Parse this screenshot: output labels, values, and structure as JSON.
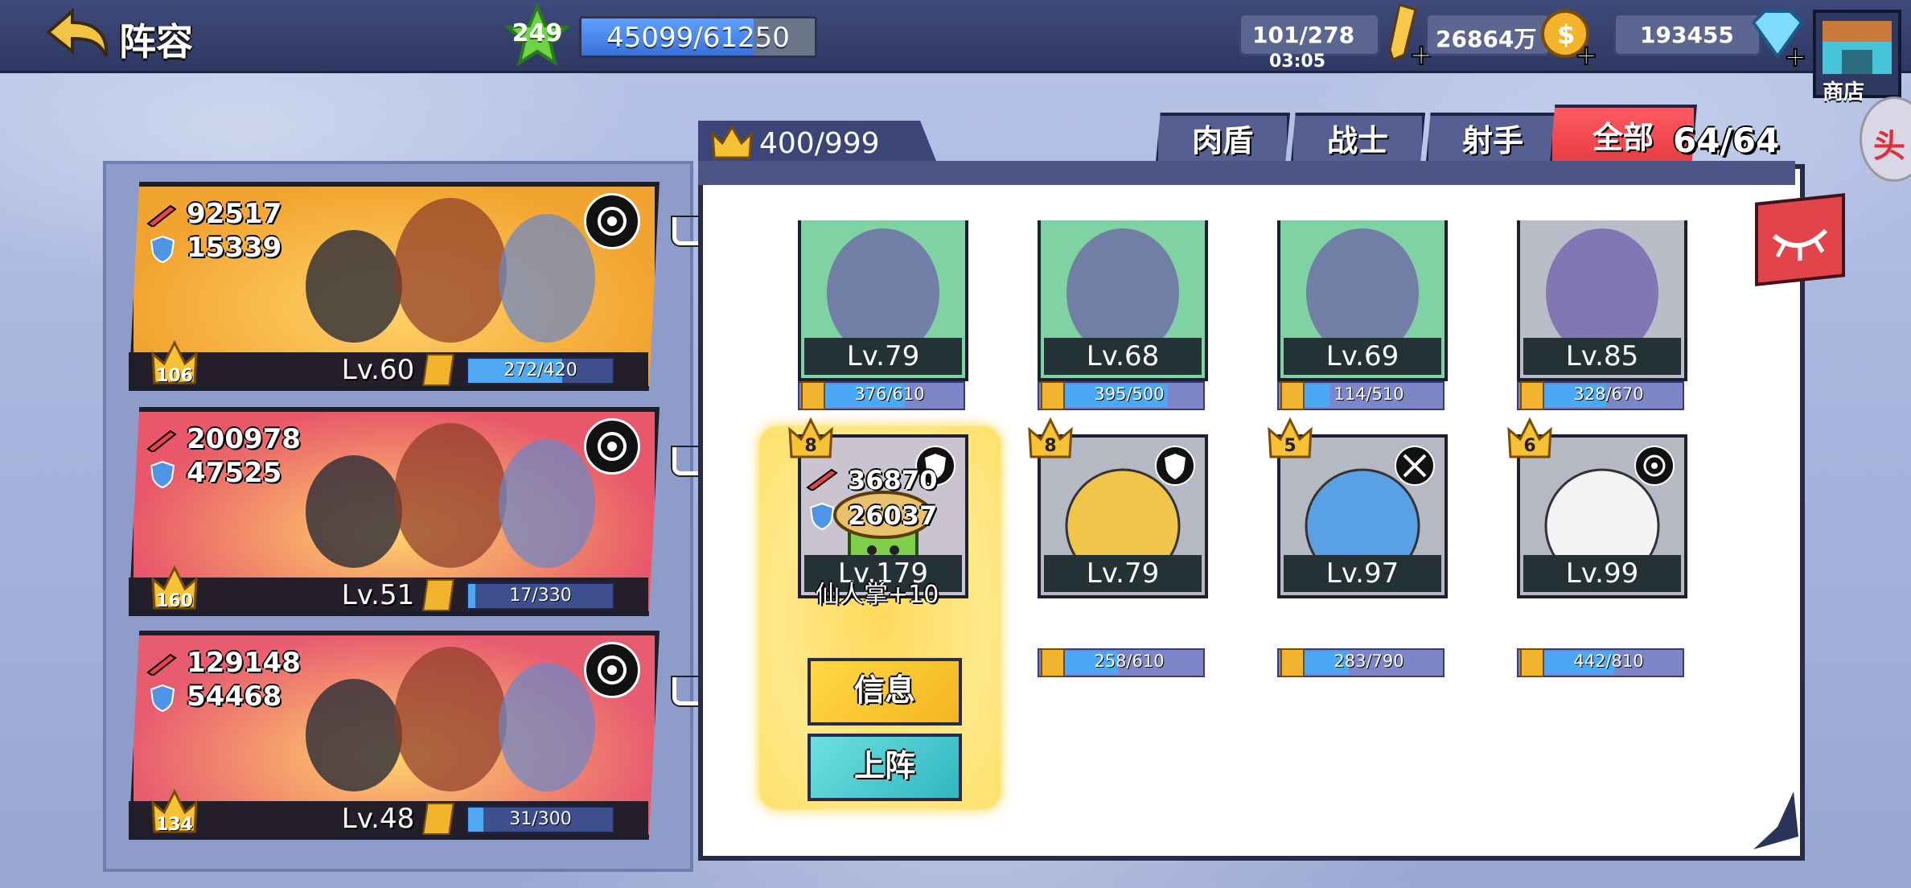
{
  "header": {
    "title": "阵容",
    "level": "249",
    "exp": {
      "text": "45099/61250",
      "current": 45099,
      "max": 61250
    },
    "energy": {
      "value": "101/278",
      "timer": "03:05"
    },
    "gold": {
      "value": "26864万"
    },
    "gems": {
      "value": "193455"
    },
    "shop_label": "商店",
    "side_button_label": "头"
  },
  "team_panel": {
    "teams": [
      {
        "attack": "92517",
        "defense": "15339",
        "crown": "106",
        "level": "Lv.60",
        "shard": "272/420",
        "shard_ratio": 0.648,
        "role_icon": "archer-target-icon",
        "bg": "#f2a430"
      },
      {
        "attack": "200978",
        "defense": "47525",
        "crown": "160",
        "level": "Lv.51",
        "shard": "17/330",
        "shard_ratio": 0.052,
        "role_icon": "archer-target-icon",
        "bg": "#e8586a"
      },
      {
        "attack": "129148",
        "defense": "54468",
        "crown": "134",
        "level": "Lv.48",
        "shard": "31/300",
        "shard_ratio": 0.103,
        "role_icon": "crossed-swords-icon",
        "bg": "#e85c70"
      }
    ]
  },
  "hero_panel": {
    "crown_count": "400/999",
    "tabs": [
      {
        "label": "肉盾",
        "active": false
      },
      {
        "label": "战士",
        "active": false
      },
      {
        "label": "射手",
        "active": false
      },
      {
        "label": "全部",
        "active": true
      }
    ],
    "total_count": "64/64",
    "heroes_row1": [
      {
        "name": "knight",
        "level": "Lv.79",
        "shard": "376/610",
        "ratio": 0.616,
        "bg": "#7fd3a2"
      },
      {
        "name": "lion-warrior",
        "level": "Lv.68",
        "shard": "395/500",
        "ratio": 0.79,
        "bg": "#7fd3a2"
      },
      {
        "name": "frog",
        "level": "Lv.69",
        "shard": "114/510",
        "ratio": 0.224,
        "bg": "#7fd3a2"
      },
      {
        "name": "panda-monk",
        "level": "Lv.85",
        "shard": "328/670",
        "ratio": 0.49,
        "bg": "#b9bdc8"
      }
    ],
    "selected_hero": {
      "crown": "8",
      "attack": "36870",
      "defense": "26037",
      "name_label": "仙人掌+10",
      "level": "Lv.179",
      "role_icon": "shield-icon",
      "info_button": "信息",
      "deploy_button": "上阵"
    },
    "heroes_row2": [
      {
        "name": "pear-sprout",
        "crown": "8",
        "level": "Lv.79",
        "shard": "258/610",
        "ratio": 0.423,
        "role_icon": "shield-icon"
      },
      {
        "name": "blue-dragon",
        "crown": "5",
        "level": "Lv.97",
        "shard": "283/790",
        "ratio": 0.358,
        "role_icon": "crossed-swords-icon"
      },
      {
        "name": "white-fluff",
        "crown": "6",
        "level": "Lv.99",
        "shard": "442/810",
        "ratio": 0.546,
        "role_icon": "archer-target-icon"
      }
    ]
  }
}
